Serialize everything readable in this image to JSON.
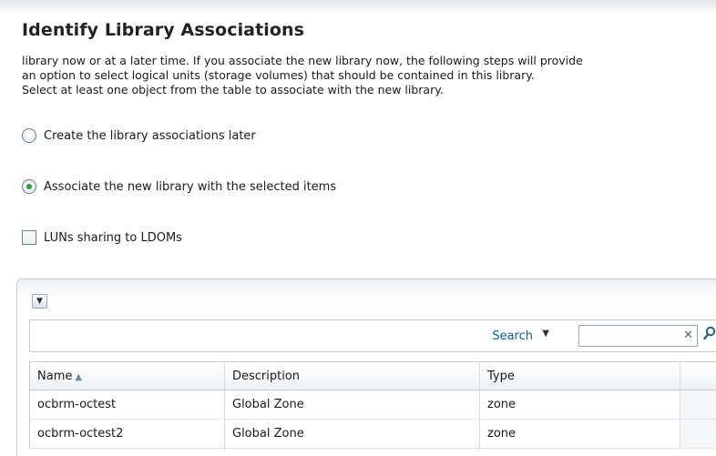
{
  "page": {
    "title": "Identify Library Associations",
    "description_lines": [
      "library now or at a later time. If you associate the new library now, the following steps will provide",
      "an option to select logical units (storage volumes) that should be contained in this library.",
      "Select at least one object from the table to associate with the new library."
    ]
  },
  "options": {
    "later_label": "Create the library associations later",
    "associate_label": "Associate the new library with the selected items",
    "selected": "associate",
    "luns_label": "LUNs sharing to LDOMs",
    "luns_checked": false
  },
  "table": {
    "menu_icon": "chevron-down-icon",
    "search_label": "Search",
    "search_value": "",
    "columns": [
      "Name",
      "Description",
      "Type"
    ],
    "sorted_column": "Name",
    "sort_direction": "ascending",
    "rows": [
      [
        "ocbrm-octest",
        "Global Zone",
        "zone"
      ],
      [
        "ocbrm-octest2",
        "Global Zone",
        "zone"
      ]
    ]
  }
}
